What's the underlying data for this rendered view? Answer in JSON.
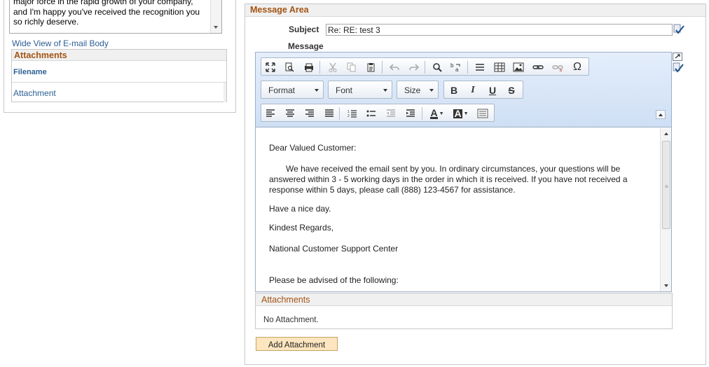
{
  "left": {
    "body_text_lines": [
      "major force in the rapid growth of your company,",
      "and I'm happy you've received the recognition you",
      "so richly deserve."
    ],
    "wide_view_link": "Wide View of E-mail Body",
    "attachments_title": "Attachments",
    "filename_header": "Filename",
    "attachment_link": "Attachment"
  },
  "message_area": {
    "title": "Message Area",
    "subject_label": "Subject",
    "subject_value": "Re: RE: test 3",
    "message_label": "Message"
  },
  "toolbar": {
    "format_label": "Format",
    "font_label": "Font",
    "size_label": "Size",
    "bold": "B",
    "italic": "I",
    "underline": "U",
    "strike": "S",
    "omega": "Ω",
    "text_color": "A",
    "bg_color": "A"
  },
  "editor": {
    "greeting": "Dear Valued Customer:",
    "para1": "We have received the email sent by you. In ordinary circumstances, your questions will be answered within 3 - 5 working days in the order in which it is received. If you have not received a response within 5 days, please call (888) 123-4567 for assistance.",
    "closing1": "Have a nice day.",
    "closing2": "Kindest Regards,",
    "signature": "National Customer Support Center",
    "advise": "Please be advised of the following:"
  },
  "editor_attachments": {
    "title": "Attachments",
    "empty_text": "No Attachment."
  },
  "add_attachment_label": "Add Attachment",
  "colors": {
    "section_title": "#a35311",
    "link": "#2b5f93",
    "add_button_bg": "#fde6bf"
  }
}
